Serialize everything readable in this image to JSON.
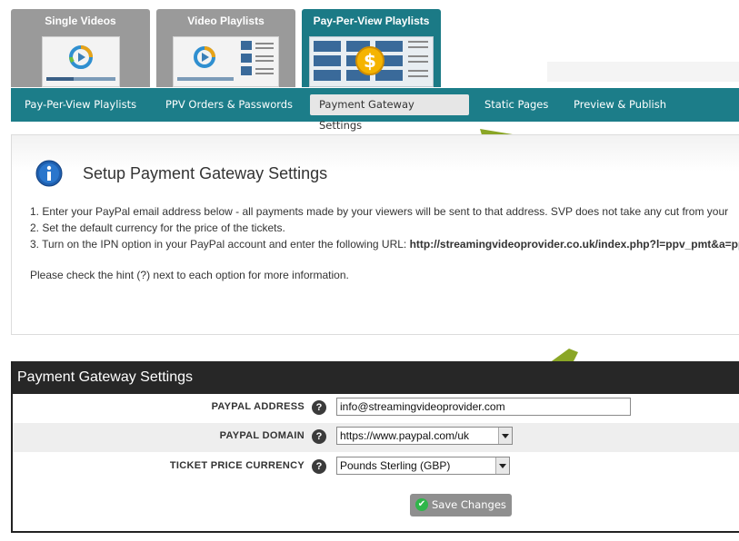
{
  "top_tabs": [
    {
      "label": "Single Videos"
    },
    {
      "label": "Video Playlists"
    },
    {
      "label": "Pay-Per-View Playlists"
    }
  ],
  "subnav": [
    {
      "label": "Pay-Per-View Playlists"
    },
    {
      "label": "PPV Orders & Passwords"
    },
    {
      "label": "Payment Gateway Settings"
    },
    {
      "label": "Static Pages"
    },
    {
      "label": "Preview & Publish"
    }
  ],
  "info": {
    "title": "Setup Payment Gateway Settings",
    "line1": "1. Enter your PayPal email address below - all payments made by your viewers will be sent to that address. SVP does not take any cut from your",
    "line2": "2. Set the default currency for the price of the tickets.",
    "line3_prefix": "3. Turn on the IPN option in your PayPal account and enter the following URL: ",
    "line3_url": "http://streamingvideoprovider.co.uk/index.php?l=ppv_pmt&a=pp",
    "hint": "Please check the hint (?) next to each option for more information."
  },
  "settings": {
    "header": "Payment Gateway Settings",
    "help_glyph": "?",
    "paypal_address": {
      "label": "PAYPAL ADDRESS",
      "value": "info@streamingvideoprovider.com"
    },
    "paypal_domain": {
      "label": "PAYPAL DOMAIN",
      "value": "https://www.paypal.com/uk"
    },
    "currency": {
      "label": "TICKET PRICE CURRENCY",
      "value": "Pounds Sterling (GBP)"
    },
    "save_label": "Save Changes"
  },
  "colors": {
    "teal": "#1c7d89",
    "arrow_green": "#8aa626",
    "header_dark": "#272727"
  }
}
